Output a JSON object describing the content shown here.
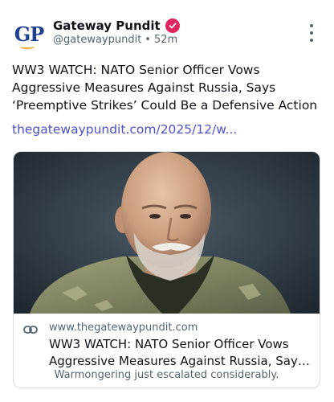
{
  "account": {
    "avatar_text": "GP",
    "display_name": "Gateway Pundit",
    "handle": "@gatewaypundit",
    "separator": "•",
    "time": "52m"
  },
  "post": {
    "text": "WW3 WATCH: NATO Senior Officer Vows Aggressive Measures Against Russia, Says ‘Preemptive Strikes’ Could Be a Defensive Action",
    "link": "thegatewaypundit.com/2025/12/w..."
  },
  "card": {
    "domain": "www.thegatewaypundit.com",
    "title_line1": "WW3 WATCH: NATO Senior Officer Vows",
    "title_line2": "Aggressive Measures Against Russia, Says ‘Pre...",
    "description": "Warmongering just escalated considerably."
  },
  "icons": {
    "verified": "verified-badge-icon",
    "more": "more-options-icon",
    "link": "link-icon"
  },
  "colors": {
    "verified": "#e0245e",
    "link": "#4d50c8",
    "brand_blue": "#1f3f8f",
    "brand_orange": "#f2a31b"
  }
}
